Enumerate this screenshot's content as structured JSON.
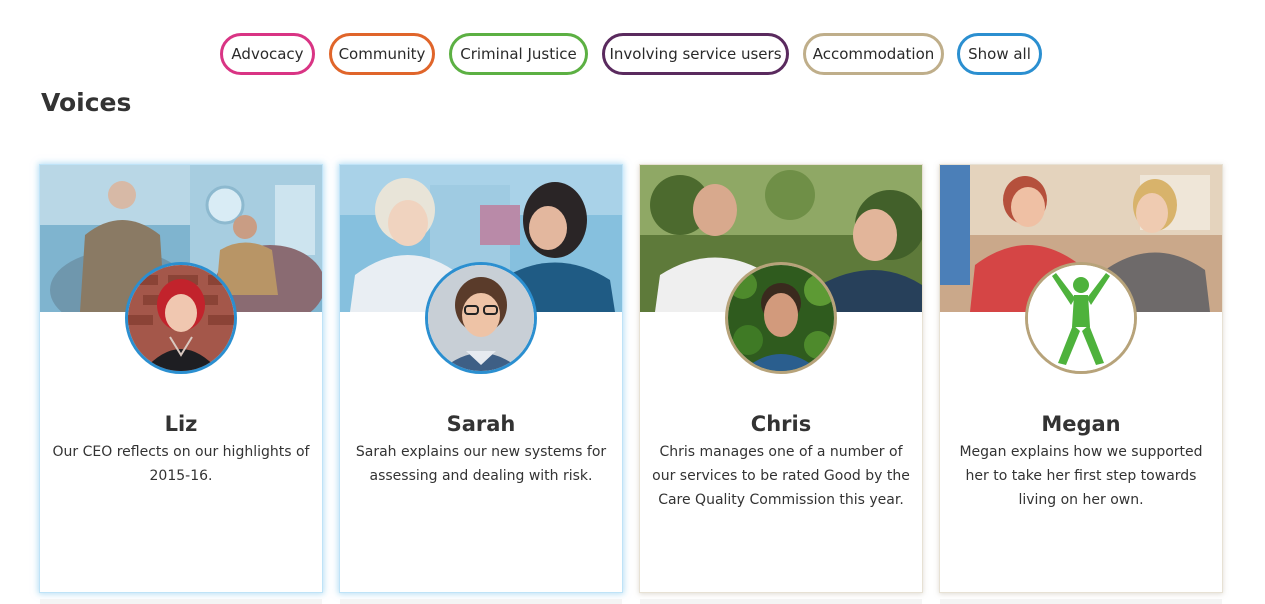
{
  "filters": [
    {
      "label": "Advocacy",
      "color": "#d93484"
    },
    {
      "label": "Community",
      "color": "#e0652a"
    },
    {
      "label": "Criminal Justice",
      "color": "#5cb043"
    },
    {
      "label": "Involving service users",
      "color": "#5a2a5e"
    },
    {
      "label": "Accommodation",
      "color": "#bfae8a"
    },
    {
      "label": "Show all",
      "color": "#2b8fd0"
    }
  ],
  "page": {
    "title": "Voices"
  },
  "cards": [
    {
      "name": "Liz",
      "description": "Our CEO reflects on our highlights of 2015-16.",
      "highlight_color": "#2b8fd0"
    },
    {
      "name": "Sarah",
      "description": "Sarah explains our new systems for assessing and dealing with risk.",
      "highlight_color": "#2b8fd0"
    },
    {
      "name": "Chris",
      "description": "Chris manages one of a number of our services to be rated Good by the Care Quality Commission this year.",
      "highlight_color": "#b7a37a"
    },
    {
      "name": "Megan",
      "description": "Megan explains how we supported her to take her first step towards living on her own.",
      "highlight_color": "#b7a37a"
    }
  ]
}
